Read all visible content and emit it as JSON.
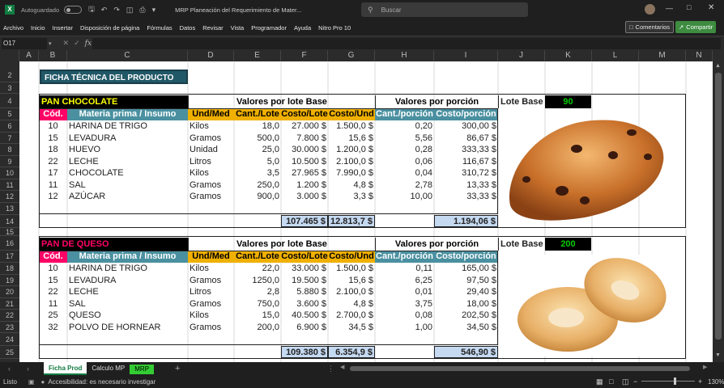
{
  "titlebar": {
    "autosave_label": "Autoguardado",
    "doc_title": "MRP Planeación del Requerimiento de Mater...",
    "search_placeholder": "Buscar"
  },
  "menu": {
    "items": [
      "Archivo",
      "Inicio",
      "Insertar",
      "Disposición de página",
      "Fórmulas",
      "Datos",
      "Revisar",
      "Vista",
      "Programador",
      "Ayuda",
      "Nitro Pro 10"
    ],
    "comments_label": "Comentarios",
    "share_label": "Compartir"
  },
  "formula": {
    "cell_ref": "O17",
    "fx": "fx",
    "value": ""
  },
  "columns": [
    "A",
    "B",
    "C",
    "D",
    "E",
    "F",
    "G",
    "H",
    "I",
    "J",
    "K",
    "L",
    "M",
    "N"
  ],
  "rows": [
    "2",
    "3",
    "4",
    "5",
    "6",
    "7",
    "8",
    "9",
    "10",
    "11",
    "12",
    "13",
    "14",
    "15",
    "16",
    "17",
    "18",
    "19",
    "20",
    "21",
    "22",
    "23",
    "24",
    "25"
  ],
  "sheet_title": "FICHA TÉCNICA DEL PRODUCTO",
  "headers": {
    "cod": "Cód.",
    "materia": "Materia prima / Insumo",
    "und": "Und/Med",
    "cant_lote": "Cant./Lote",
    "costo_lote": "Costo/Lote",
    "costo_und": "Costo/Und",
    "cant_porcion": "Cant./porción",
    "costo_porcion": "Costo/porción",
    "valores_lote": "Valores por lote Base",
    "valores_porcion": "Valores por porción",
    "lote_base": "Lote Base"
  },
  "products": [
    {
      "name": "PAN CHOCOLATE",
      "lote_base": "90",
      "image": "chocolate-bread",
      "rows": [
        [
          "10",
          "HARINA DE TRIGO",
          "Kilos",
          "18,0",
          "27.000 $",
          "1.500,0 $",
          "0,20",
          "300,00 $"
        ],
        [
          "15",
          "LEVADURA",
          "Gramos",
          "500,0",
          "7.800 $",
          "15,6 $",
          "5,56",
          "86,67 $"
        ],
        [
          "18",
          "HUEVO",
          "Unidad",
          "25,0",
          "30.000 $",
          "1.200,0 $",
          "0,28",
          "333,33 $"
        ],
        [
          "22",
          "LECHE",
          "Litros",
          "5,0",
          "10.500 $",
          "2.100,0 $",
          "0,06",
          "116,67 $"
        ],
        [
          "17",
          "CHOCOLATE",
          "Kilos",
          "3,5",
          "27.965 $",
          "7.990,0 $",
          "0,04",
          "310,72 $"
        ],
        [
          "11",
          "SAL",
          "Gramos",
          "250,0",
          "1.200 $",
          "4,8 $",
          "2,78",
          "13,33 $"
        ],
        [
          "12",
          "AZÚCAR",
          "Gramos",
          "900,0",
          "3.000 $",
          "3,3 $",
          "10,00",
          "33,33 $"
        ]
      ],
      "total_costo_lote": "107.465 $",
      "total_costo_und": "12.813,7 $",
      "total_porcion": "1.194,06 $"
    },
    {
      "name": "PAN DE QUESO",
      "lote_base": "200",
      "image": "cheese-bread",
      "rows": [
        [
          "10",
          "HARINA DE TRIGO",
          "Kilos",
          "22,0",
          "33.000 $",
          "1.500,0 $",
          "0,11",
          "165,00 $"
        ],
        [
          "15",
          "LEVADURA",
          "Gramos",
          "1250,0",
          "19.500 $",
          "15,6 $",
          "6,25",
          "97,50 $"
        ],
        [
          "22",
          "LECHE",
          "Litros",
          "2,8",
          "5.880 $",
          "2.100,0 $",
          "0,01",
          "29,40 $"
        ],
        [
          "11",
          "SAL",
          "Gramos",
          "750,0",
          "3.600 $",
          "4,8 $",
          "3,75",
          "18,00 $"
        ],
        [
          "25",
          "QUESO",
          "Kilos",
          "15,0",
          "40.500 $",
          "2.700,0 $",
          "0,08",
          "202,50 $"
        ],
        [
          "32",
          "POLVO DE HORNEAR",
          "Gramos",
          "200,0",
          "6.900 $",
          "34,5 $",
          "1,00",
          "34,50 $"
        ]
      ],
      "total_costo_lote": "109.380 $",
      "total_costo_und": "6.354,9 $",
      "total_porcion": "546,90 $"
    }
  ],
  "sheets": [
    "Ficha Prod",
    "Calculo MP",
    "MRP"
  ],
  "status": {
    "ready": "Listo",
    "accessibility": "Accesibilidad: es necesario investigar",
    "zoom": "130%"
  },
  "colors": {
    "title_bg": "#215867",
    "orange": "#f0b000",
    "pink": "#ff0066",
    "teal": "#4a90a0",
    "green": "#00cc00",
    "total_bg": "#c5d9f1"
  }
}
